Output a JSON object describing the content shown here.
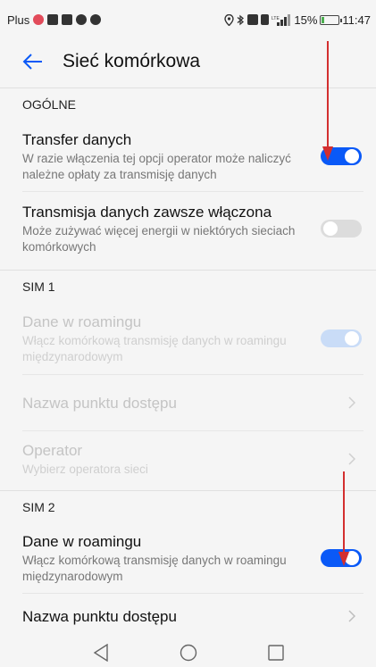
{
  "status_bar": {
    "carrier": "Plus",
    "battery": "15%",
    "time": "11:47"
  },
  "header": {
    "title": "Sieć komórkowa",
    "back_icon": "arrow-left-icon"
  },
  "sections": [
    {
      "header": "OGÓLNE",
      "rows": [
        {
          "title": "Transfer danych",
          "subtitle": "W razie włączenia tej opcji operator może naliczyć należne opłaty za transmisję danych",
          "control": "toggle-on"
        },
        {
          "title": "Transmisja danych zawsze włączona",
          "subtitle": "Może zużywać więcej energii w niektórych sieciach komórkowych",
          "control": "toggle-off"
        }
      ]
    },
    {
      "header": "SIM 1",
      "rows": [
        {
          "title": "Dane w roamingu",
          "subtitle": "Włącz komórkową transmisję danych w roamingu międzynarodowym",
          "control": "toggle-on-disabled"
        },
        {
          "title": "Nazwa punktu dostępu",
          "control": "chevron"
        },
        {
          "title": "Operator",
          "subtitle": "Wybierz operatora sieci",
          "control": "chevron"
        }
      ]
    },
    {
      "header": "SIM 2",
      "rows": [
        {
          "title": "Dane w roamingu",
          "subtitle": "Włącz komórkową transmisję danych w roamingu międzynarodowym",
          "control": "toggle-on"
        },
        {
          "title": "Nazwa punktu dostępu",
          "control": "chevron"
        }
      ]
    }
  ],
  "colors": {
    "accent": "#0a59f7",
    "annotation_arrow": "#d32f2f"
  }
}
